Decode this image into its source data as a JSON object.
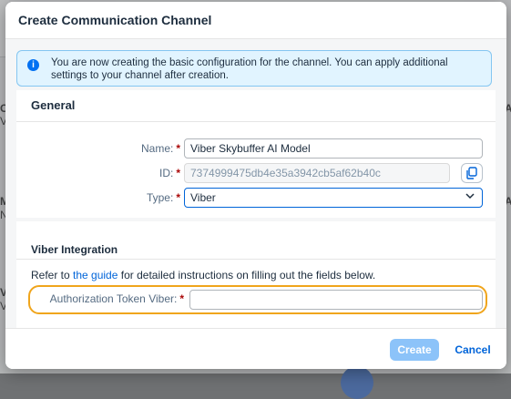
{
  "background": {
    "left_chars": [
      "C",
      "V",
      "M",
      "N",
      "V",
      "V"
    ],
    "right_chars": [
      "A",
      "A"
    ]
  },
  "dialog": {
    "title": "Create Communication Channel",
    "info_message": "You are now creating the basic configuration for the channel. You can apply additional settings to your channel after creation.",
    "general": {
      "title": "General",
      "name_label": "Name:",
      "name_value": "Viber Skybuffer AI Model",
      "id_label": "ID:",
      "id_value": "7374999475db4e35a3942cb5af62b40c",
      "type_label": "Type:",
      "type_value": "Viber",
      "required_mark": "*"
    },
    "viber": {
      "title": "Viber Integration",
      "refer_prefix": "Refer to ",
      "refer_link": "the guide",
      "refer_suffix": " for detailed instructions on filling out the fields below.",
      "token_label": "Authorization Token Viber:",
      "token_value": ""
    },
    "footer": {
      "create_label": "Create",
      "cancel_label": "Cancel"
    }
  },
  "colors": {
    "accent": "#0064d9",
    "required": "#aa0808",
    "highlight": "#f0a51c",
    "info_bg": "#e1f4ff"
  }
}
